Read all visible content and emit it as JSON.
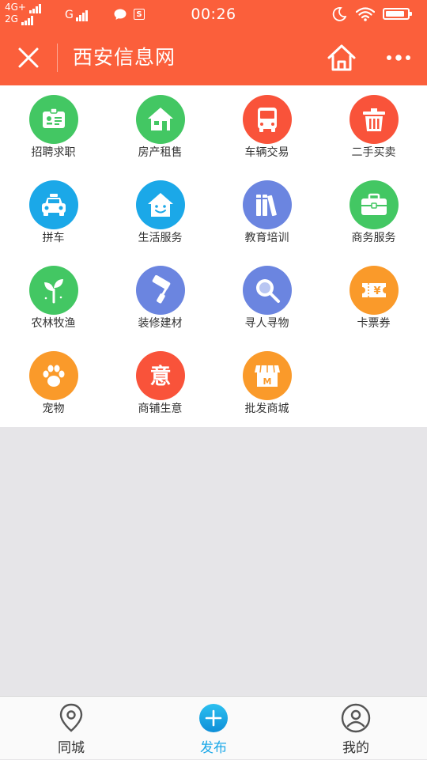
{
  "status_bar": {
    "net1": "4G+",
    "net2": "2G",
    "net3": "G",
    "time": "00:26",
    "battery_level": 0.9
  },
  "navbar": {
    "title": "西安信息网"
  },
  "categories": [
    {
      "label": "招聘求职",
      "icon": "id-card-icon",
      "color": "#43c763"
    },
    {
      "label": "房产租售",
      "icon": "house-icon",
      "color": "#43c763"
    },
    {
      "label": "车辆交易",
      "icon": "bus-icon",
      "color": "#f9533a"
    },
    {
      "label": "二手买卖",
      "icon": "trash-bin-icon",
      "color": "#f9533a"
    },
    {
      "label": "拼车",
      "icon": "taxi-icon",
      "color": "#1ba8e8"
    },
    {
      "label": "生活服务",
      "icon": "smiling-house-icon",
      "color": "#1ba8e8"
    },
    {
      "label": "教育培训",
      "icon": "books-icon",
      "color": "#6b85e0"
    },
    {
      "label": "商务服务",
      "icon": "briefcase-icon",
      "color": "#43c763"
    },
    {
      "label": "农林牧渔",
      "icon": "sprout-icon",
      "color": "#43c763"
    },
    {
      "label": "装修建材",
      "icon": "paint-roller-icon",
      "color": "#6b85e0"
    },
    {
      "label": "寻人寻物",
      "icon": "magnifier-icon",
      "color": "#6b85e0"
    },
    {
      "label": "卡票券",
      "icon": "ticket-icon",
      "color": "#fa9a2a"
    },
    {
      "label": "宠物",
      "icon": "paw-icon",
      "color": "#fa9a2a"
    },
    {
      "label": "商铺生意",
      "icon": "yi-character-icon",
      "icon_text": "意",
      "color": "#f9533a"
    },
    {
      "label": "批发商城",
      "icon": "shop-icon",
      "icon_text": "M",
      "color": "#fa9a2a"
    }
  ],
  "ticket_symbol": "¥",
  "tabbar": {
    "tabs": [
      {
        "label": "同城",
        "icon": "location-pin-icon"
      },
      {
        "label": "发布",
        "icon": "plus-circle-icon"
      },
      {
        "label": "我的",
        "icon": "user-circle-icon"
      }
    ],
    "active_color": "#1ba8e8"
  }
}
